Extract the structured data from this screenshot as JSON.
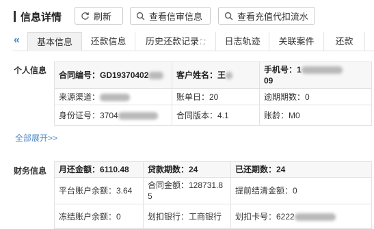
{
  "header": {
    "title": "信息详情",
    "refresh_label": "刷新",
    "audit_label": "查看信审信息",
    "recharge_label": "查看充值代扣流水"
  },
  "tabs": {
    "left_arrow": "«",
    "right_arrow": "»",
    "items": [
      "基本信息",
      "还款信息",
      "历史还款记录",
      "日志轨迹",
      "关联案件",
      "还款"
    ],
    "active_index": 0
  },
  "personal": {
    "section_label": "个人信息",
    "contract_no": "合同编号：GD19370402",
    "customer_name": "客户姓名：王",
    "phone": "手机号：1",
    "phone_cont": "09",
    "channel": "来源渠道：",
    "bill_day": "账单日：20",
    "overdue_periods": "逾期期数：0",
    "id_no": "身份证号：3704",
    "contract_version": "合同版本：4.1",
    "account_age": "账龄：M0"
  },
  "expand_all": "全部展开>>",
  "finance": {
    "section_label": "财务信息",
    "monthly_repay": "月还金额：6110.48",
    "loan_periods": "贷款期数：24",
    "repaid_periods": "已还期数：24",
    "platform_balance": "平台账户余额：3.64",
    "contract_amount": "合同金额：128731.8",
    "contract_amount_cont": "5",
    "prepay_amount": "提前结清金额：0",
    "frozen_balance": "冻结账户余额：0",
    "deduct_bank": "划扣银行：工商银行",
    "deduct_card": "划扣卡号：6222"
  }
}
